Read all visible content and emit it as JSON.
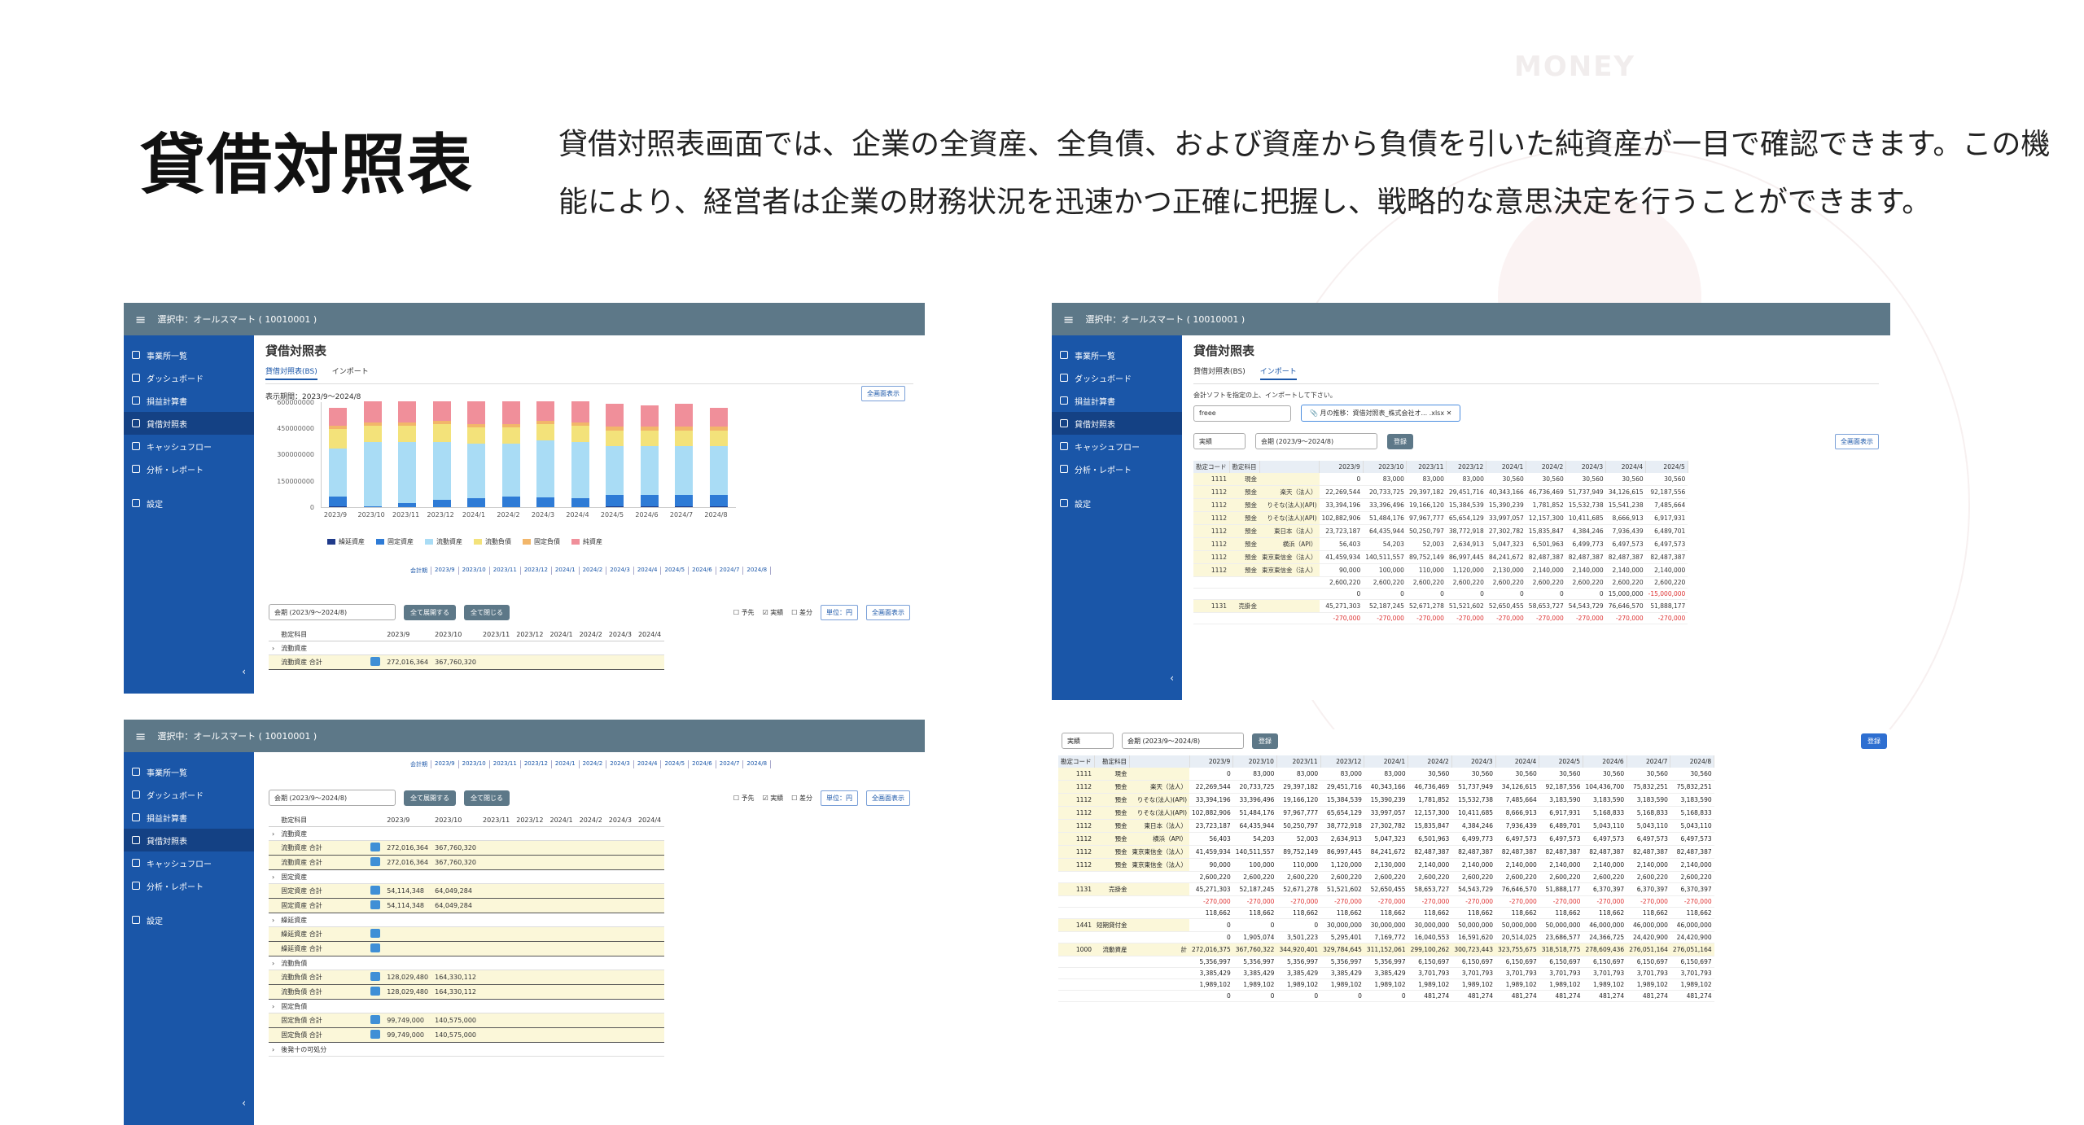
{
  "watermark": {
    "money": "MONEY"
  },
  "heading": "貸借対照表",
  "description": "貸借対照表画面では、企業の全資産、全負債、および資産から負債を引いた純資産が一目で確認できます。この機能により、経営者は企業の財務状況を迅速かつ正確に把握し、戦略的な意思決定を行うことができます。",
  "app": {
    "topbar_label": "選択中：オールスマート ( 10010001 )",
    "menu_icon": "hamburger-icon",
    "sidebar": [
      {
        "label": "事業所一覧",
        "icon": "building-icon"
      },
      {
        "label": "ダッシュボード",
        "icon": "grid-icon"
      },
      {
        "label": "損益計算書",
        "icon": "document-icon"
      },
      {
        "label": "貸借対照表",
        "icon": "document-icon",
        "active": true
      },
      {
        "label": "キャッシュフロー",
        "icon": "flow-icon"
      },
      {
        "label": "分析・レポート",
        "icon": "report-icon"
      },
      {
        "label": "設定",
        "icon": "gear-icon"
      }
    ]
  },
  "screen1": {
    "title": "貸借対照表",
    "tabs": [
      "貸借対照表(BS)",
      "インポート"
    ],
    "period": "表示期間：2023/9〜2024/8",
    "fullscreen": "全画面表示",
    "chart_data": {
      "type": "bar",
      "categories": [
        "2023/9",
        "2023/10",
        "2023/11",
        "2023/12",
        "2024/1",
        "2024/2",
        "2024/3",
        "2024/4",
        "2024/5",
        "2024/6",
        "2024/7",
        "2024/8"
      ],
      "ylim": [
        0,
        600000000
      ],
      "yticks": [
        "600000000",
        "450000000",
        "300000000",
        "150000000",
        "0"
      ],
      "series": [
        {
          "name": "繰延資産",
          "color": "#1f3a8a",
          "values": [
            5000000,
            5000000,
            5000000,
            5000000,
            5000000,
            5000000,
            5000000,
            5000000,
            5000000,
            5000000,
            5000000,
            5000000
          ]
        },
        {
          "name": "固定資産",
          "color": "#2e7bd6",
          "values": [
            54000000,
            64000000,
            64000000,
            64000000,
            64000000,
            64000000,
            64000000,
            64000000,
            64000000,
            64000000,
            64000000,
            64000000
          ]
        },
        {
          "name": "流動資産",
          "color": "#a9dcf5",
          "values": [
            272000000,
            367000000,
            345000000,
            330000000,
            311000000,
            300000000,
            323000000,
            318000000,
            276000000,
            276000000,
            276000000,
            276000000
          ]
        },
        {
          "name": "流動負債",
          "color": "#f3e27a",
          "values": [
            110000000,
            90000000,
            90000000,
            100000000,
            90000000,
            90000000,
            90000000,
            90000000,
            90000000,
            90000000,
            90000000,
            90000000
          ]
        },
        {
          "name": "固定負債",
          "color": "#f2b66a",
          "values": [
            20000000,
            20000000,
            20000000,
            20000000,
            20000000,
            20000000,
            20000000,
            20000000,
            20000000,
            20000000,
            20000000,
            20000000
          ]
        },
        {
          "name": "純資産",
          "color": "#f08f9a",
          "values": [
            100000000,
            120000000,
            120000000,
            110000000,
            130000000,
            130000000,
            110000000,
            120000000,
            130000000,
            120000000,
            130000000,
            110000000
          ]
        }
      ]
    },
    "period_tabs": [
      "会計期",
      "2023/9",
      "2023/10",
      "2023/11",
      "2023/12",
      "2024/1",
      "2024/2",
      "2024/3",
      "2024/4",
      "2024/5",
      "2024/6",
      "2024/7",
      "2024/8"
    ],
    "controls": {
      "select_label": "会期 (2023/9〜2024/8)",
      "expand_all": "全て展開する",
      "collapse_all": "全て閉じる",
      "check_budget": "予先",
      "check_actual": "実績",
      "check_diff": "差分",
      "unit": "単位：円",
      "fullscreen": "全画面表示"
    },
    "table": {
      "headers": [
        "",
        "勘定科目",
        "",
        "2023/9",
        "2023/10",
        "2023/11",
        "2023/12",
        "2024/1",
        "2024/2",
        "2024/3",
        "2024/4"
      ],
      "rows": [
        {
          "type": "grp",
          "label": "流動資産"
        },
        {
          "type": "sum",
          "label": "流動資産 合計",
          "v1": "272,016,364",
          "v2": "367,760,320"
        }
      ]
    }
  },
  "screen2": {
    "title": "貸借対照表",
    "tabs": [
      "貸借対照表(BS)",
      "インポート"
    ],
    "import_note": "会計ソフトを指定の上、インポートして下さい。",
    "software": "freee",
    "file_name": "月の推移：資借対照表_株式会社オ... .xlsx",
    "period_select": "会期 (2023/9〜2024/8)",
    "type_select": "実績",
    "save_button": "登録",
    "fullscreen": "全画面表示",
    "headers": [
      "勘定コード",
      "勘定科目",
      "",
      "2023/9",
      "2023/10",
      "2023/11",
      "2023/12",
      "2024/1",
      "2024/2",
      "2024/3",
      "2024/4",
      "2024/5"
    ],
    "rows": [
      [
        "1111",
        "現金",
        "",
        "0",
        "83,000",
        "83,000",
        "83,000",
        "30,560",
        "30,560",
        "30,560",
        "30,560",
        "30,560"
      ],
      [
        "1112",
        "預金",
        "楽天（法人）",
        "22,269,544",
        "20,733,725",
        "29,397,182",
        "29,451,716",
        "40,343,166",
        "46,736,469",
        "51,737,949",
        "34,126,615",
        "92,187,556"
      ],
      [
        "1112",
        "預金",
        "りそな(法人)(API)",
        "33,394,196",
        "33,396,496",
        "19,166,120",
        "15,384,539",
        "15,390,239",
        "1,781,852",
        "15,532,738",
        "15,541,238",
        "7,485,664"
      ],
      [
        "1112",
        "預金",
        "りそな(法人)(API)",
        "102,882,906",
        "51,484,176",
        "97,967,777",
        "65,654,129",
        "33,997,057",
        "12,157,300",
        "10,411,685",
        "8,666,913",
        "6,917,931"
      ],
      [
        "1112",
        "預金",
        "東日本（法人）",
        "23,723,187",
        "64,435,944",
        "50,250,797",
        "38,772,918",
        "27,302,782",
        "15,835,847",
        "4,384,246",
        "7,936,439",
        "6,489,701"
      ],
      [
        "1112",
        "預金",
        "横浜（API）",
        "56,403",
        "54,203",
        "52,003",
        "2,634,913",
        "5,047,323",
        "6,501,963",
        "6,499,773",
        "6,497,573",
        "6,497,573"
      ],
      [
        "1112",
        "預金",
        "東京東信金（法人）",
        "41,459,934",
        "140,511,557",
        "89,752,149",
        "86,997,445",
        "84,241,672",
        "82,487,387",
        "82,487,387",
        "82,487,387",
        "82,487,387"
      ],
      [
        "1112",
        "預金",
        "東京東信金（法人）",
        "90,000",
        "100,000",
        "110,000",
        "1,120,000",
        "2,130,000",
        "2,140,000",
        "2,140,000",
        "2,140,000",
        "2,140,000"
      ],
      [
        "",
        "",
        "",
        "2,600,220",
        "2,600,220",
        "2,600,220",
        "2,600,220",
        "2,600,220",
        "2,600,220",
        "2,600,220",
        "2,600,220",
        "2,600,220"
      ],
      [
        "",
        "",
        "",
        "0",
        "0",
        "0",
        "0",
        "0",
        "0",
        "0",
        "15,000,000",
        "-15,000,000"
      ],
      [
        "1131",
        "売掛金",
        "",
        "45,271,303",
        "52,187,245",
        "52,671,278",
        "51,521,602",
        "52,650,455",
        "58,653,727",
        "54,543,729",
        "76,646,570",
        "51,888,177"
      ],
      [
        "",
        "",
        "",
        "-270,000",
        "-270,000",
        "-270,000",
        "-270,000",
        "-270,000",
        "-270,000",
        "-270,000",
        "-270,000",
        "-270,000"
      ]
    ]
  },
  "screen3": {
    "period_tabs": [
      "会計期",
      "2023/9",
      "2023/10",
      "2023/11",
      "2023/12",
      "2024/1",
      "2024/2",
      "2024/3",
      "2024/4",
      "2024/5",
      "2024/6",
      "2024/7",
      "2024/8"
    ],
    "table": {
      "rows": [
        {
          "type": "grp",
          "label": "流動資産"
        },
        {
          "type": "sum",
          "label": "流動資産 合計",
          "v1": "272,016,364",
          "v2": "367,760,320"
        },
        {
          "type": "sum",
          "label": "流動資産 合計",
          "v1": "272,016,364",
          "v2": "367,760,320"
        },
        {
          "type": "grp",
          "label": "固定資産"
        },
        {
          "type": "sum",
          "label": "固定資産 合計",
          "v1": "54,114,348",
          "v2": "64,049,284"
        },
        {
          "type": "sum",
          "label": "固定資産 合計",
          "v1": "54,114,348",
          "v2": "64,049,284"
        },
        {
          "type": "grp",
          "label": "繰延資産"
        },
        {
          "type": "sum",
          "label": "繰延資産 合計",
          "v1": "",
          "v2": ""
        },
        {
          "type": "sum",
          "label": "繰延資産 合計",
          "v1": "",
          "v2": ""
        },
        {
          "type": "grp",
          "label": "流動負債"
        },
        {
          "type": "sum",
          "label": "流動負債 合計",
          "v1": "128,029,480",
          "v2": "164,330,112"
        },
        {
          "type": "sum",
          "label": "流動負債 合計",
          "v1": "128,029,480",
          "v2": "164,330,112"
        },
        {
          "type": "grp",
          "label": "固定負債"
        },
        {
          "type": "sum",
          "label": "固定負債 合計",
          "v1": "99,749,000",
          "v2": "140,575,000"
        },
        {
          "type": "sum",
          "label": "固定負債 合計",
          "v1": "99,749,000",
          "v2": "140,575,000"
        },
        {
          "type": "grp",
          "label": "後発十の可処分"
        }
      ]
    }
  },
  "screen4": {
    "type_select": "実績",
    "period_select": "会期 (2023/9〜2024/8)",
    "save_button": "登録",
    "register_button": "登録",
    "headers": [
      "勘定コード",
      "勘定科目",
      "",
      "2023/9",
      "2023/10",
      "2023/11",
      "2023/12",
      "2024/1",
      "2024/2",
      "2024/3",
      "2024/4",
      "2024/5",
      "2024/6",
      "2024/7",
      "2024/8"
    ],
    "rows": [
      [
        "1111",
        "現金",
        "",
        "0",
        "83,000",
        "83,000",
        "83,000",
        "83,000",
        "30,560",
        "30,560",
        "30,560",
        "30,560",
        "30,560",
        "30,560",
        "30,560"
      ],
      [
        "1112",
        "預金",
        "楽天（法人）",
        "22,269,544",
        "20,733,725",
        "29,397,182",
        "29,451,716",
        "40,343,166",
        "46,736,469",
        "51,737,949",
        "34,126,615",
        "92,187,556",
        "104,436,700",
        "75,832,251",
        "75,832,251"
      ],
      [
        "1112",
        "預金",
        "りそな(法人)(API)",
        "33,394,196",
        "33,396,496",
        "19,166,120",
        "15,384,539",
        "15,390,239",
        "1,781,852",
        "15,532,738",
        "7,485,664",
        "3,183,590",
        "3,183,590",
        "3,183,590",
        "3,183,590"
      ],
      [
        "1112",
        "預金",
        "りそな(法人)(API)",
        "102,882,906",
        "51,484,176",
        "97,967,777",
        "65,654,129",
        "33,997,057",
        "12,157,300",
        "10,411,685",
        "8,666,913",
        "6,917,931",
        "5,168,833",
        "5,168,833",
        "5,168,833"
      ],
      [
        "1112",
        "預金",
        "東日本（法人）",
        "23,723,187",
        "64,435,944",
        "50,250,797",
        "38,772,918",
        "27,302,782",
        "15,835,847",
        "4,384,246",
        "7,936,439",
        "6,489,701",
        "5,043,110",
        "5,043,110",
        "5,043,110"
      ],
      [
        "1112",
        "預金",
        "横浜（API）",
        "56,403",
        "54,203",
        "52,003",
        "2,634,913",
        "5,047,323",
        "6,501,963",
        "6,499,773",
        "6,497,573",
        "6,497,573",
        "6,497,573",
        "6,497,573",
        "6,497,573"
      ],
      [
        "1112",
        "預金",
        "東京東信金（法人）",
        "41,459,934",
        "140,511,557",
        "89,752,149",
        "86,997,445",
        "84,241,672",
        "82,487,387",
        "82,487,387",
        "82,487,387",
        "82,487,387",
        "82,487,387",
        "82,487,387",
        "82,487,387"
      ],
      [
        "1112",
        "預金",
        "東京東信金（法人）",
        "90,000",
        "100,000",
        "110,000",
        "1,120,000",
        "2,130,000",
        "2,140,000",
        "2,140,000",
        "2,140,000",
        "2,140,000",
        "2,140,000",
        "2,140,000",
        "2,140,000"
      ],
      [
        "",
        "",
        "",
        "2,600,220",
        "2,600,220",
        "2,600,220",
        "2,600,220",
        "2,600,220",
        "2,600,220",
        "2,600,220",
        "2,600,220",
        "2,600,220",
        "2,600,220",
        "2,600,220",
        "2,600,220"
      ],
      [
        "1131",
        "売掛金",
        "",
        "45,271,303",
        "52,187,245",
        "52,671,278",
        "51,521,602",
        "52,650,455",
        "58,653,727",
        "54,543,729",
        "76,646,570",
        "51,888,177",
        "6,370,397",
        "6,370,397",
        "6,370,397"
      ],
      [
        "",
        "",
        "",
        "-270,000",
        "-270,000",
        "-270,000",
        "-270,000",
        "-270,000",
        "-270,000",
        "-270,000",
        "-270,000",
        "-270,000",
        "-270,000",
        "-270,000",
        "-270,000"
      ],
      [
        "",
        "",
        "",
        "118,662",
        "118,662",
        "118,662",
        "118,662",
        "118,662",
        "118,662",
        "118,662",
        "118,662",
        "118,662",
        "118,662",
        "118,662",
        "118,662"
      ],
      [
        "1441",
        "短期貸付金",
        "",
        "0",
        "0",
        "0",
        "30,000,000",
        "30,000,000",
        "30,000,000",
        "50,000,000",
        "50,000,000",
        "50,000,000",
        "46,000,000",
        "46,000,000",
        "46,000,000"
      ],
      [
        "",
        "",
        "",
        "0",
        "1,905,074",
        "3,501,223",
        "5,295,401",
        "7,169,772",
        "16,040,553",
        "16,591,620",
        "20,514,025",
        "23,686,577",
        "24,366,725",
        "24,420,900",
        "24,420,900"
      ],
      [
        "1000",
        "流動資産",
        "計",
        "272,016,375",
        "367,760,322",
        "344,920,401",
        "329,784,645",
        "311,152,061",
        "299,100,262",
        "300,723,443",
        "323,755,675",
        "318,518,775",
        "278,609,436",
        "276,051,164",
        "276,051,164"
      ],
      [
        "",
        "",
        "",
        "5,356,997",
        "5,356,997",
        "5,356,997",
        "5,356,997",
        "5,356,997",
        "6,150,697",
        "6,150,697",
        "6,150,697",
        "6,150,697",
        "6,150,697",
        "6,150,697",
        "6,150,697"
      ],
      [
        "",
        "",
        "",
        "3,385,429",
        "3,385,429",
        "3,385,429",
        "3,385,429",
        "3,385,429",
        "3,701,793",
        "3,701,793",
        "3,701,793",
        "3,701,793",
        "3,701,793",
        "3,701,793",
        "3,701,793"
      ],
      [
        "",
        "",
        "",
        "1,989,102",
        "1,989,102",
        "1,989,102",
        "1,989,102",
        "1,989,102",
        "1,989,102",
        "1,989,102",
        "1,989,102",
        "1,989,102",
        "1,989,102",
        "1,989,102",
        "1,989,102"
      ],
      [
        "",
        "",
        "",
        "0",
        "0",
        "0",
        "0",
        "0",
        "481,274",
        "481,274",
        "481,274",
        "481,274",
        "481,274",
        "481,274",
        "481,274"
      ]
    ]
  }
}
